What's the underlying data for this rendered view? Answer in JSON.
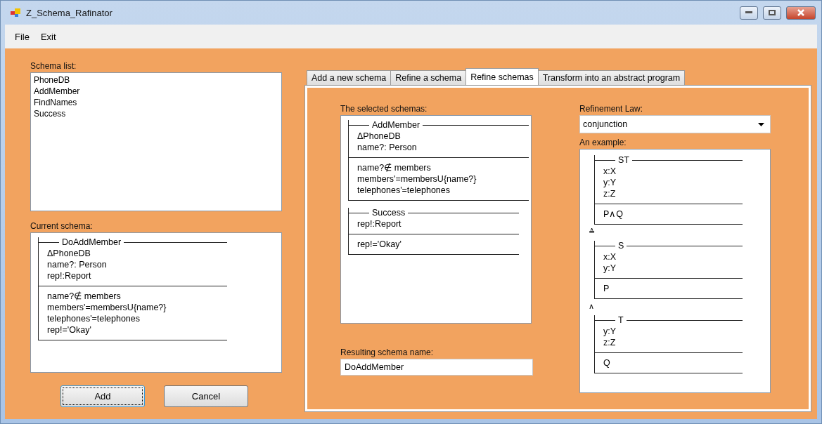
{
  "window": {
    "title": "Z_Schema_Rafinator"
  },
  "menu": [
    "File",
    "Exit"
  ],
  "schema_list": {
    "label": "Schema list:",
    "items": [
      {
        "text": "PhoneDB",
        "selected": false
      },
      {
        "text": "AddMember",
        "selected": false
      },
      {
        "text": "FindNames",
        "selected": false
      },
      {
        "text": "Success",
        "selected": false
      }
    ]
  },
  "current_schema": {
    "label": "Current schema:",
    "schemas": [
      {
        "name": "DoAddMember",
        "declarations": [
          "ΔPhoneDB",
          "name?: Person",
          "rep!:Report"
        ],
        "predicates": [
          "name?∉ members",
          "members'=membersU{name?}",
          "telephones'=telephones",
          "rep!='Okay'"
        ]
      }
    ]
  },
  "buttons": [
    {
      "label": "Add",
      "focused": true
    },
    {
      "label": "Cancel",
      "focused": false
    }
  ],
  "tabs": [
    {
      "label": "Add a new schema",
      "selected": false
    },
    {
      "label": "Refine a schema",
      "selected": false
    },
    {
      "label": "Refine schemas",
      "selected": true
    },
    {
      "label": "Transform into an abstract program",
      "selected": false
    }
  ],
  "selected_schemas": {
    "label": "The selected schemas:",
    "schemas": [
      {
        "name": "AddMember",
        "declarations": [
          "ΔPhoneDB",
          "name?: Person"
        ],
        "predicates": [
          "name?∉ members",
          "members'=membersU{name?}",
          "telephones'=telephones"
        ]
      },
      {
        "name": "Success",
        "declarations": [
          "rep!:Report"
        ],
        "predicates": [
          "rep!='Okay'"
        ]
      }
    ]
  },
  "resulting_name": {
    "label": "Resulting schema name:",
    "value": "DoAddMember"
  },
  "refinement_law": {
    "label": "Refinement Law:",
    "value": "conjunction"
  },
  "example": {
    "label": "An example:",
    "items": [
      {
        "kind": "schema",
        "name": "ST",
        "declarations": [
          "x:X",
          "y:Y",
          "z:Z"
        ],
        "predicates": [
          "P∧Q"
        ]
      },
      {
        "kind": "operator",
        "symbol": "≙"
      },
      {
        "kind": "schema",
        "name": "S",
        "declarations": [
          "x:X",
          "y:Y"
        ],
        "predicates": [
          "P"
        ]
      },
      {
        "kind": "operator",
        "symbol": "∧"
      },
      {
        "kind": "schema",
        "name": "T",
        "declarations": [
          "y:Y",
          "z:Z"
        ],
        "predicates": [
          "Q"
        ]
      }
    ]
  }
}
